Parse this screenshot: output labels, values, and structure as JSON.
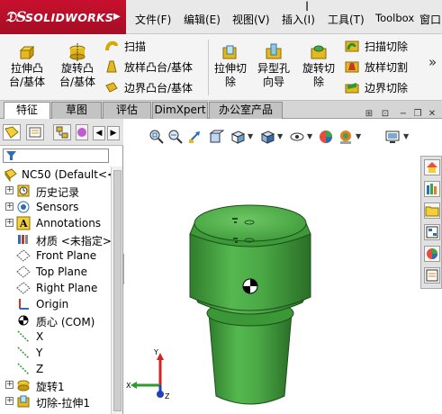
{
  "title_bar": {
    "logo_text": "SOLIDWORKS",
    "menus": [
      {
        "label": "文件(F)"
      },
      {
        "label": "编辑(E)"
      },
      {
        "label": "视图(V)"
      },
      {
        "label": "插入(I)"
      },
      {
        "label": "工具(T)"
      },
      {
        "label": "Toolbox"
      },
      {
        "label": "窗口"
      }
    ]
  },
  "command_manager": {
    "extrude_boss": "拉伸凸台/基体",
    "revolve_boss": "旋转凸台/基体",
    "sweep": "扫描",
    "loft_boss": "放样凸台/基体",
    "boundary_boss": "边界凸台/基体",
    "extrude_cut": "拉伸切除",
    "hole_wizard": "异型孔向导",
    "revolve_cut": "旋转切除",
    "sweep_cut": "扫描切除",
    "loft_cut": "放样切割",
    "boundary_cut": "边界切除",
    "more": "»"
  },
  "tabs": [
    "特征",
    "草图",
    "评估",
    "DimXpert",
    "办公室产品"
  ],
  "feature_tree": {
    "root": "NC50  (Default<<",
    "items": [
      {
        "label": "历史记录",
        "icon": "history-icon",
        "expandable": true
      },
      {
        "label": "Sensors",
        "icon": "sensor-icon",
        "expandable": true
      },
      {
        "label": "Annotations",
        "icon": "annotation-icon",
        "expandable": true
      },
      {
        "label": "材质 <未指定>",
        "icon": "material-icon",
        "expandable": false
      },
      {
        "label": "Front Plane",
        "icon": "plane-icon",
        "expandable": false
      },
      {
        "label": "Top Plane",
        "icon": "plane-icon",
        "expandable": false
      },
      {
        "label": "Right Plane",
        "icon": "plane-icon",
        "expandable": false
      },
      {
        "label": "Origin",
        "icon": "origin-icon",
        "expandable": false
      },
      {
        "label": "质心 (COM)",
        "icon": "center-of-mass-icon",
        "expandable": false
      },
      {
        "label": "X",
        "icon": "axis-icon",
        "expandable": false
      },
      {
        "label": "Y",
        "icon": "axis-icon",
        "expandable": false
      },
      {
        "label": "Z",
        "icon": "axis-icon",
        "expandable": false
      },
      {
        "label": "旋转1",
        "icon": "revolve-icon",
        "expandable": true
      },
      {
        "label": "切除-拉伸1",
        "icon": "cut-extrude-icon",
        "expandable": true
      }
    ]
  },
  "triad": {
    "x": "X",
    "y": "Y",
    "z": "Z"
  },
  "colors": {
    "brand_red": "#c8102e",
    "model_green": "#3f9e3a",
    "model_dark": "#2a6e27",
    "axis_red": "#d92020",
    "axis_green": "#2f9a2f",
    "axis_blue": "#2040c0"
  }
}
